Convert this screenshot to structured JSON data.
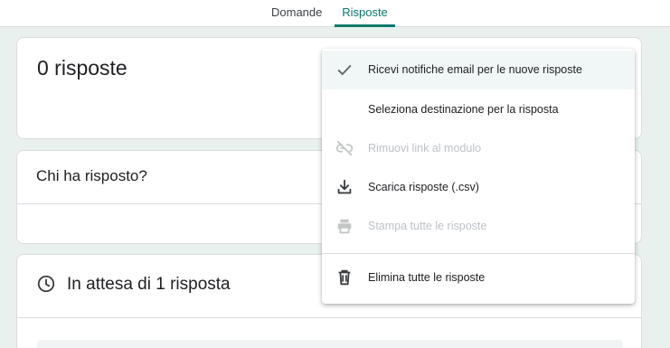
{
  "tabs": [
    {
      "label": "Domande",
      "active": false
    },
    {
      "label": "Risposte",
      "active": true
    }
  ],
  "summary": {
    "title": "0 risposte"
  },
  "respondents": {
    "title": "Chi ha risposto?"
  },
  "pending": {
    "title": "In attesa di 1 risposta"
  },
  "menu": {
    "items": [
      {
        "label": "Ricevi notifiche email per le nuove risposte",
        "icon": "check-icon",
        "enabled": true,
        "checked": true
      },
      {
        "label": "Seleziona destinazione per la risposta",
        "icon": "",
        "enabled": true
      },
      {
        "label": "Rimuovi link al modulo",
        "icon": "link-off-icon",
        "enabled": false
      },
      {
        "label": "Scarica risposte (.csv)",
        "icon": "download-icon",
        "enabled": true
      },
      {
        "label": "Stampa tutte le risposte",
        "icon": "print-icon",
        "enabled": false
      },
      {
        "label": "Elimina tutte le risposte",
        "icon": "trash-icon",
        "enabled": true
      }
    ]
  },
  "colors": {
    "accent": "#087a6a",
    "page_background": "#e8f1ee",
    "disabled_text": "#bdc1c6"
  }
}
